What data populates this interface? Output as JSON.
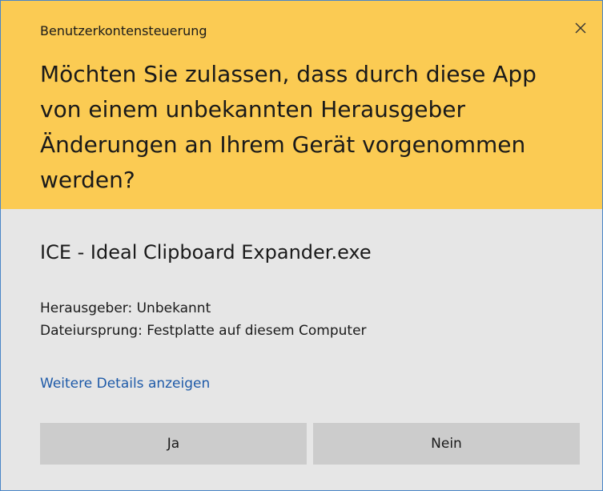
{
  "dialog": {
    "title": "Benutzerkontensteuerung",
    "question": "Möchten Sie zulassen, dass durch diese App von einem unbekannten Herausgeber Änderungen an Ihrem Gerät vorgenommen werden?",
    "header_color": "#fbcb53",
    "close_icon": "close-icon"
  },
  "app": {
    "name": "ICE - Ideal Clipboard Expander.exe",
    "publisher": "Herausgeber: Unbekannt",
    "origin": "Dateiursprung: Festplatte auf diesem Computer"
  },
  "links": {
    "details": "Weitere Details anzeigen"
  },
  "buttons": {
    "yes": "Ja",
    "no": "Nein"
  }
}
